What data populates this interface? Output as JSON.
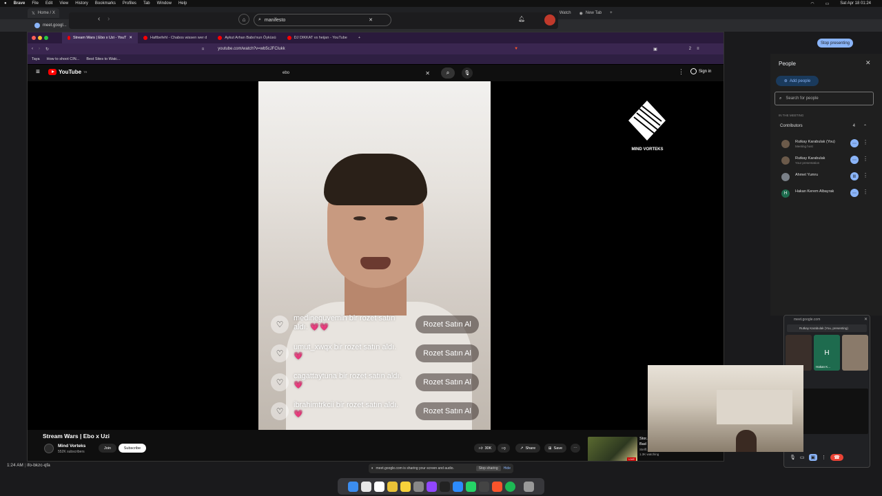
{
  "menubar": {
    "app": "Brave",
    "items": [
      "File",
      "Edit",
      "View",
      "History",
      "Bookmarks",
      "Profiles",
      "Tab",
      "Window",
      "Help"
    ],
    "datetime": "Sat Apr 18 01:24"
  },
  "meet_chrome": {
    "tabs": [
      "Home / X",
      "Watch",
      "New Tab"
    ],
    "url": "meet.googl...",
    "search_value": "manifesto",
    "stop_presenting": "Stop presenting"
  },
  "brave": {
    "tabs": [
      {
        "label": "Stream Wars | Ebo x Uzi - YouT",
        "color": "#ff0000"
      },
      {
        "label": "Haftbefehl - Chabos wissen wer d",
        "color": "#ff0000"
      },
      {
        "label": "Aykut Arhan Babo'nun Öyküsü",
        "color": "#ff0000"
      },
      {
        "label": "DJ DIKKAT vs heijan - YouTube",
        "color": "#ff0000"
      }
    ],
    "url": "youtube.com/watch?v=wb5cJFCIukk",
    "bookmarks": [
      "Taya",
      "How to shoot CIN...",
      "Best Sites to Watc..."
    ],
    "tab_count": "2"
  },
  "youtube": {
    "logo": "YouTube",
    "logo_country": "TR",
    "search_value": "ebo",
    "sign_in": "Sign in",
    "video_title": "Stream Wars | Ebo x Uzi",
    "channel": "Mind Vorteks",
    "subs": "552K subscribers",
    "join": "Join",
    "subscribe": "Subscribe",
    "likes": "30K",
    "share": "Share",
    "save": "Save",
    "overlay_channel": "MIND VORTEKS",
    "rec_title": "Stor...",
    "rec_sub": "Bad",
    "rec_channel": "Stellf...",
    "rec_live": "LIVE",
    "rec_watching": "1.3K watching",
    "comments": [
      {
        "text": "medineguvemin bir rozet satın aldı. 💗💗",
        "button": "Rozet Satın Al"
      },
      {
        "text": "umut_xwqx bir rozet satın aldı. 💗",
        "button": "Rozet Satın Al"
      },
      {
        "text": "cagattaytuna bir rozet satın aldı. 💗",
        "button": "Rozet Satın Al"
      },
      {
        "text": "ibrahimtrkcii bir rozet satın aldı. 💗",
        "button": "Rozet Satın Al"
      }
    ]
  },
  "share_bar": {
    "text": "meet.google.com is sharing your screen and audio.",
    "stop": "Stop sharing",
    "hide": "Hide"
  },
  "people": {
    "title": "People",
    "add": "Add people",
    "search_placeholder": "Search for people",
    "section": "IN THE MEETING",
    "group": "Contributors",
    "count": "4",
    "list": [
      {
        "name": "Rutkay Karabulak (You)",
        "sub": "Meeting host",
        "initial": ""
      },
      {
        "name": "Rutkay Karabulak",
        "sub": "Your presentation",
        "initial": ""
      },
      {
        "name": "Ahmet Yumru",
        "sub": "",
        "initial": ""
      },
      {
        "name": "Hakan Kerem Albayrak",
        "sub": "",
        "initial": "H"
      }
    ]
  },
  "minimeet": {
    "url": "meet.google.com",
    "presenting": "Rutkay Karabulak (You, presenting)",
    "tile_name": "Hakan K...",
    "tile_initial": "H"
  },
  "bottom": {
    "time": "1:24 AM",
    "code": "ifo-bkzc-qfa"
  },
  "colors": {
    "accent": "#8ab4f8",
    "youtube_red": "#ff0000",
    "brave_tab": "#3d2a55"
  }
}
